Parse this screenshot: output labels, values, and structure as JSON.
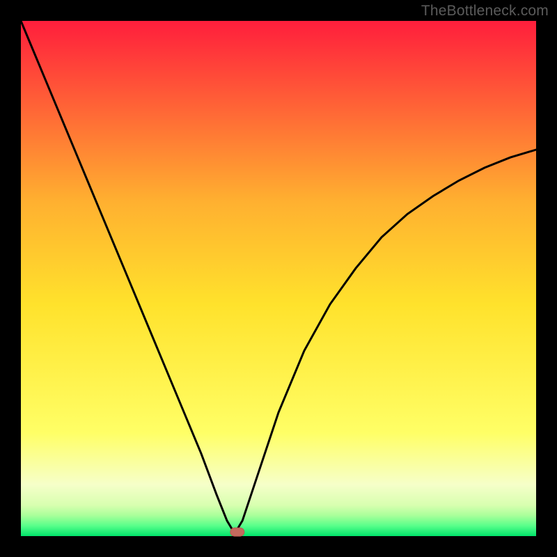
{
  "watermark": "TheBottleneck.com",
  "colors": {
    "frame": "#000000",
    "grad_top": "#ff1e3c",
    "grad_mid_upper": "#ffb030",
    "grad_mid": "#ffe22c",
    "grad_lower": "#ffff66",
    "grad_pale": "#f6ffc9",
    "grad_band1": "#d8ffb0",
    "grad_band2": "#a9ff9a",
    "grad_band3": "#58ff8a",
    "grad_bottom": "#00e36b",
    "curve": "#000000",
    "marker_fill": "#c46a5e",
    "marker_stroke": "#b85a50"
  },
  "chart_data": {
    "type": "line",
    "title": "",
    "xlabel": "",
    "ylabel": "",
    "xlim": [
      0,
      100
    ],
    "ylim": [
      0,
      100
    ],
    "grid": false,
    "legend": false,
    "series": [
      {
        "name": "bottleneck-curve",
        "x_pct": [
          0,
          5,
          10,
          15,
          20,
          25,
          30,
          35,
          38,
          40,
          41.5,
          43,
          46,
          50,
          55,
          60,
          65,
          70,
          75,
          80,
          85,
          90,
          95,
          100
        ],
        "y_pct": [
          100,
          88,
          76,
          64,
          52,
          40,
          28,
          16,
          8,
          3,
          0.5,
          3,
          12,
          24,
          36,
          45,
          52,
          58,
          62.5,
          66,
          69,
          71.5,
          73.5,
          75
        ]
      }
    ],
    "marker": {
      "name": "optimal-point",
      "x_pct": 42,
      "y_pct": 0.8,
      "shape": "rounded-rect"
    },
    "gradient_stops_pct": [
      {
        "offset": 0,
        "color": "#ff1e3c"
      },
      {
        "offset": 35,
        "color": "#ffb030"
      },
      {
        "offset": 55,
        "color": "#ffe22c"
      },
      {
        "offset": 80,
        "color": "#ffff66"
      },
      {
        "offset": 90,
        "color": "#f6ffc9"
      },
      {
        "offset": 94,
        "color": "#d8ffb0"
      },
      {
        "offset": 96,
        "color": "#a9ff9a"
      },
      {
        "offset": 98,
        "color": "#58ff8a"
      },
      {
        "offset": 100,
        "color": "#00e36b"
      }
    ]
  }
}
